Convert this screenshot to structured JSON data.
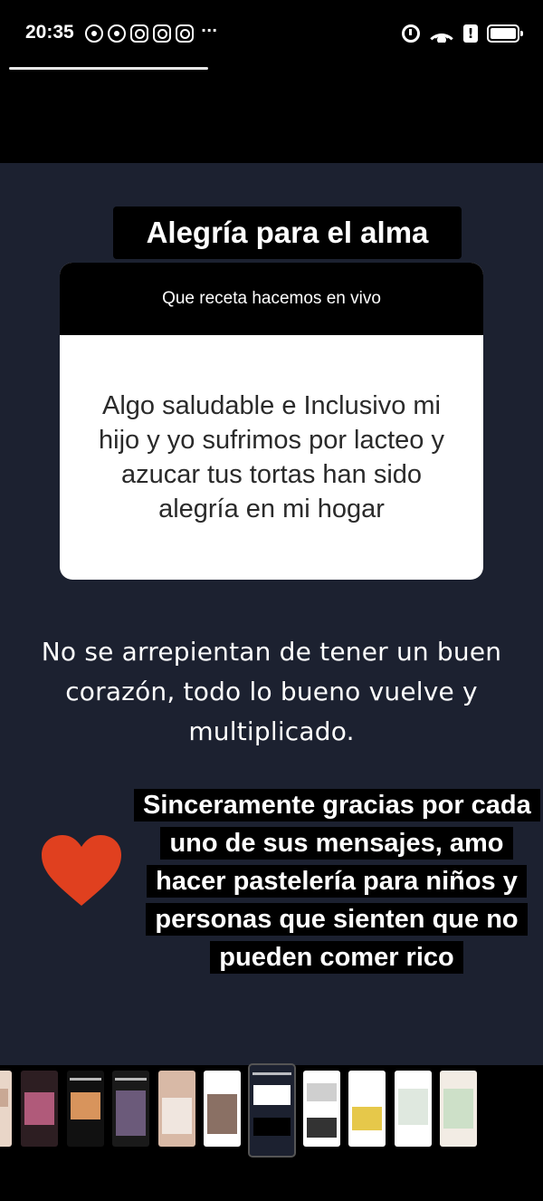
{
  "status_bar": {
    "time": "20:35",
    "notification_icons": [
      "whatsapp-business-icon",
      "whatsapp-icon",
      "instagram-icon",
      "instagram-icon",
      "instagram-icon"
    ],
    "more": "···",
    "system_icons": [
      "alarm-icon",
      "wifi-icon",
      "alert-icon",
      "battery-icon"
    ],
    "alert_glyph": "!"
  },
  "story": {
    "progress": 0.38,
    "title": "Alegría para el alma",
    "question": "Que receta hacemos en vivo",
    "answer": "Algo saludable e Inclusivo mi hijo y yo sufrimos por lacteo y azucar tus tortas han sido alegría en mi hogar",
    "quote": "No se arrepientan de tener un buen corazón, todo lo bueno vuelve y multiplicado.",
    "thanks": "Sinceramente gracias por cada uno de sus mensajes, amo hacer pastelería para niños y personas que sienten que no pueden comer rico",
    "heart_color": "#e0401f",
    "background_color": "#1c2130"
  },
  "thumbnails": {
    "count": 12,
    "active_index": 6
  }
}
